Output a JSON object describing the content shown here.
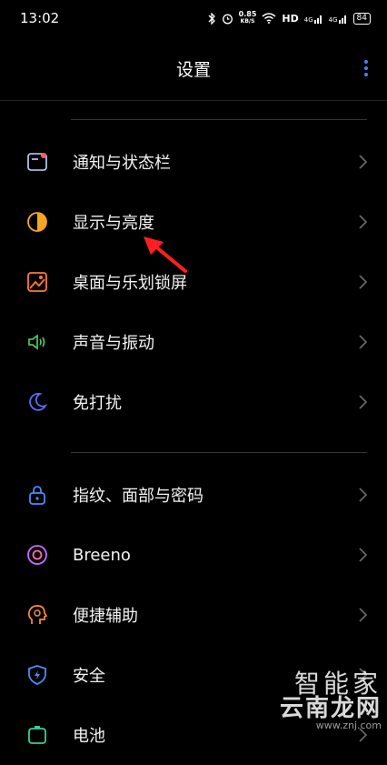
{
  "status_bar": {
    "time": "13:02",
    "net_speed_value": "0.85",
    "net_speed_unit": "KB/S",
    "hd_label": "HD",
    "signal1": "4G",
    "signal2": "4G",
    "battery": "84"
  },
  "header": {
    "title": "设置"
  },
  "groups": [
    {
      "items": [
        {
          "label": "通知与状态栏",
          "icon": "notification-icon"
        },
        {
          "label": "显示与亮度",
          "icon": "brightness-icon"
        },
        {
          "label": "桌面与乐划锁屏",
          "icon": "wallpaper-icon"
        },
        {
          "label": "声音与振动",
          "icon": "sound-icon"
        },
        {
          "label": "免打扰",
          "icon": "moon-icon"
        }
      ]
    },
    {
      "items": [
        {
          "label": "指纹、面部与密码",
          "icon": "lock-icon"
        },
        {
          "label": "Breeno",
          "icon": "breeno-icon"
        },
        {
          "label": "便捷辅助",
          "icon": "assist-icon"
        },
        {
          "label": "安全",
          "icon": "security-icon"
        },
        {
          "label": "电池",
          "icon": "battery-icon"
        }
      ]
    }
  ],
  "colors": {
    "notification": "#ff5a5f",
    "brightness": "#f5a623",
    "wallpaper": "#ff7a2f",
    "sound": "#4cd964",
    "moon": "#5b6cff",
    "lock": "#4a8cff",
    "breeno": "#c86bff",
    "assist": "#ff8c3a",
    "security": "#4a8cff",
    "battery": "#2fd39a",
    "annotation": "#ff1f1f"
  },
  "watermark": {
    "line1": "智能家",
    "line2": "云南龙网",
    "url": "www.znj.com"
  }
}
